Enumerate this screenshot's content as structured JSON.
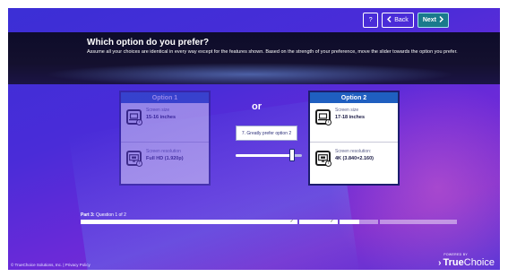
{
  "toolbar": {
    "help_label": "?",
    "back_label": "Back",
    "next_label": "Next"
  },
  "banner": {
    "title": "Which option do you prefer?",
    "subtitle": "Assume all your choices are identical in every way except for the features shown. Based on the strength of your preference, move the slider towards the option you prefer."
  },
  "options": [
    {
      "title": "Option 1",
      "attributes": [
        {
          "icon": "laptop-icon",
          "label": "Screen size",
          "value": "15-16 inches"
        },
        {
          "icon": "monitor-icon",
          "label": "Screen resolution",
          "value": "Full HD (1.920p)"
        }
      ],
      "selected": false
    },
    {
      "title": "Option 2",
      "attributes": [
        {
          "icon": "laptop-icon",
          "label": "Screen size",
          "value": "17-18 inches"
        },
        {
          "icon": "monitor-icon",
          "label": "Screen resolution:",
          "value": "4K (3.840×2.160)"
        }
      ],
      "selected": true
    }
  ],
  "choice": {
    "or_label": "or",
    "preference_text": "7. Greatly prefer option 2",
    "slider_level": 0.88
  },
  "progress": {
    "part_label": "Part 3:",
    "question_label": "Question 1 of 2",
    "check_glyph": "✓"
  },
  "footer": {
    "copyright": "© TrueChoice Solutions, Inc. | Privacy Policy"
  },
  "brand": {
    "powered_by": "POWERED BY",
    "name_bold": "True",
    "name_regular": "Choice"
  },
  "colors": {
    "header_blue": "#1f5fc0",
    "card_border": "#1d1d6e",
    "next_button": "#1a7a8c"
  }
}
